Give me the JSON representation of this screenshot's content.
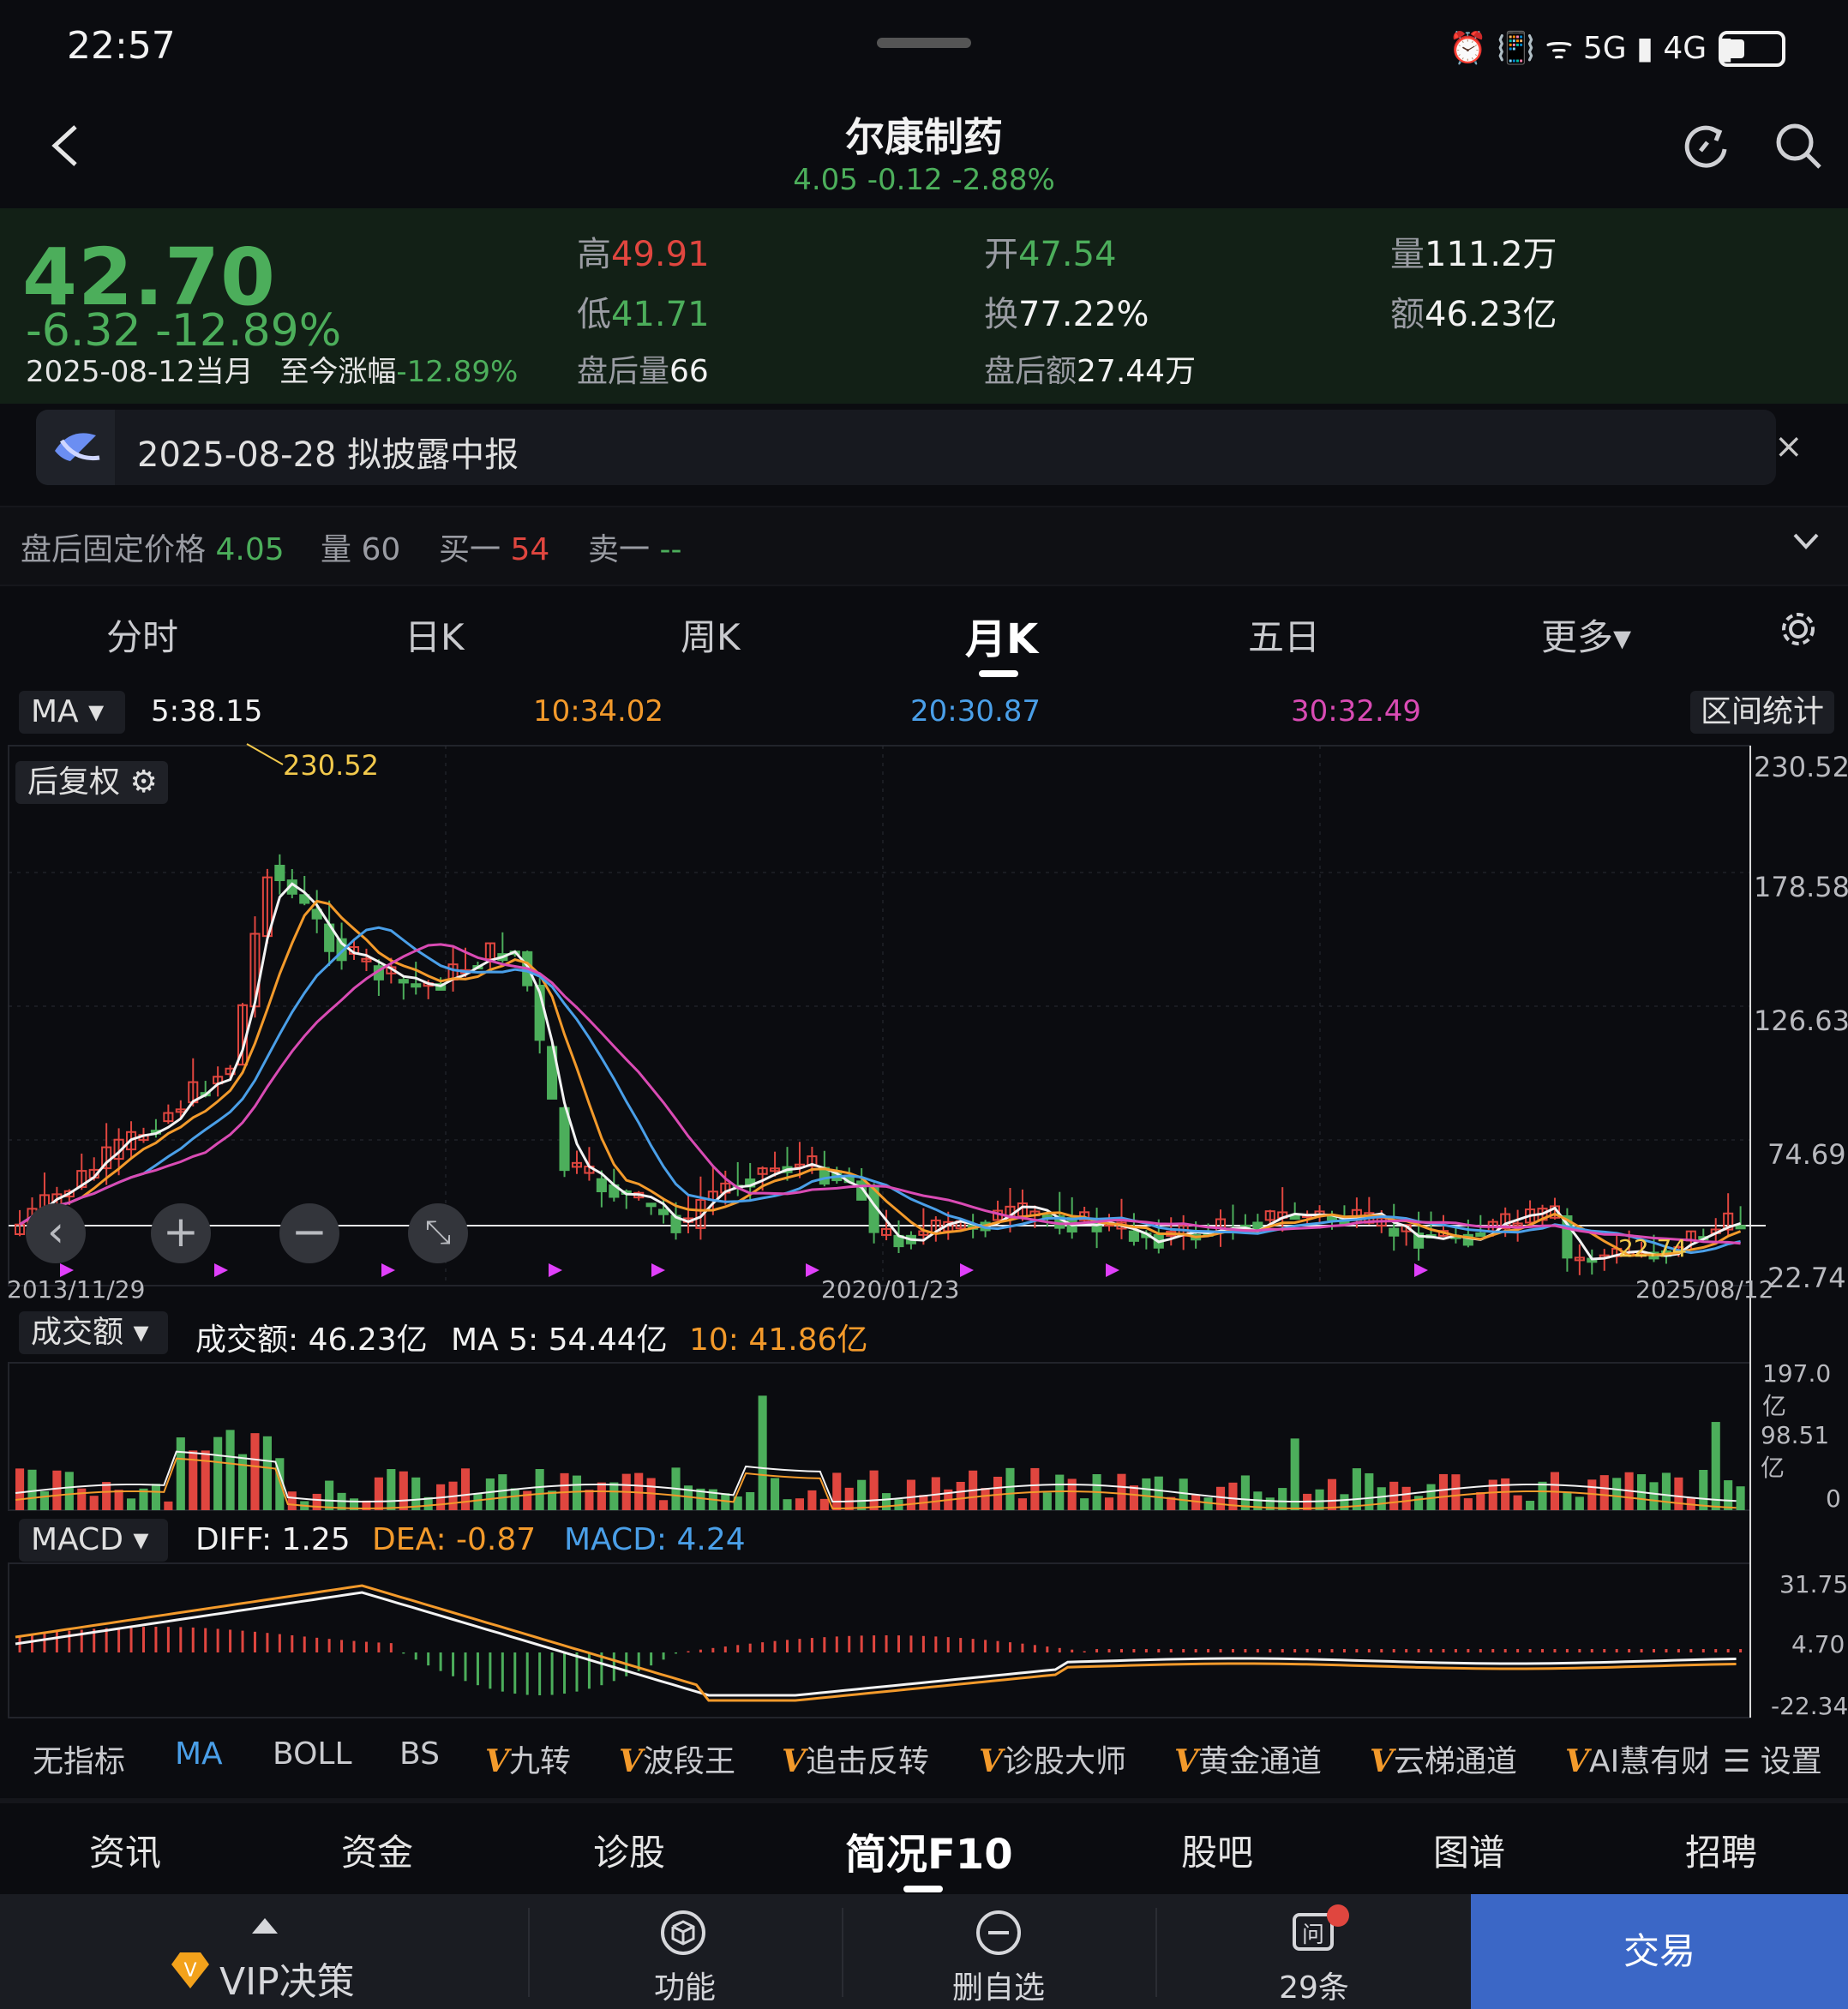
{
  "status_bar": {
    "time": "22:57",
    "icons": "⏰ 📳 ᯤ 5G ▮ 4G ▮"
  },
  "header": {
    "title": "尔康制药",
    "subtitle": "4.05  -0.12  -2.88%"
  },
  "quote": {
    "price": "42.70",
    "change": "-6.32  -12.89%",
    "date": "2025-08-12当月",
    "to_date_label": "至今涨幅",
    "to_date_value": "-12.89%",
    "high_label": "高",
    "high": "49.91",
    "low_label": "低",
    "low": "41.71",
    "ah_vol_label": "盘后量",
    "ah_vol": "66",
    "open_label": "开",
    "open": "47.54",
    "turnover_label": "换",
    "turnover": "77.22%",
    "ah_amt_label": "盘后额",
    "ah_amt": "27.44万",
    "vol_label": "量",
    "vol": "111.2万",
    "amt_label": "额",
    "amt": "46.23亿"
  },
  "notice": {
    "text": "2025-08-28 拟披露中报",
    "close": "×"
  },
  "after_hours": {
    "fixed_label": "盘后固定价格",
    "fixed_value": "4.05",
    "vol_label": "量",
    "vol_value": "60",
    "buy_label": "买一",
    "buy_value": "54",
    "sell_label": "卖一",
    "sell_value": "--"
  },
  "tabs": [
    "分时",
    "日K",
    "周K",
    "月K",
    "五日",
    "更多▾"
  ],
  "ma_legend": {
    "select": "MA ▾",
    "ma5": "5:38.15",
    "ma10": "10:34.02",
    "ma20": "20:30.87",
    "ma30": "30:32.49",
    "range_stat": "区间统计"
  },
  "chart_data": {
    "type": "candlestick",
    "adjust_tag": "后复权 ⚙",
    "y_ticks": [
      "230.52",
      "178.58",
      "126.63",
      "74.69",
      "22.74"
    ],
    "ylim": [
      22.74,
      230.52
    ],
    "max_label": "230.52",
    "x_labels": [
      "2013/11/29",
      "2020/01/23",
      "2025/08/12"
    ],
    "last_label": "22.74",
    "volume": {
      "select": "成交额 ▾",
      "amount": "成交额: 46.23亿",
      "ma5": "MA 5: 54.44亿",
      "ma10": "10: 41.86亿",
      "y_ticks": [
        "197.0亿",
        "98.51亿",
        "0"
      ]
    },
    "macd": {
      "select": "MACD ▾",
      "diff": "DIFF: 1.25",
      "dea": "DEA: -0.87",
      "macd": "MACD: 4.24",
      "y_ticks": [
        "31.75",
        "4.70",
        "-22.34"
      ]
    }
  },
  "indicators": [
    "无指标",
    "MA",
    "BOLL",
    "BS",
    "九转",
    "波段王",
    "追击反转",
    "诊股大师",
    "黄金通道",
    "云梯通道",
    "AI慧有财",
    "设置"
  ],
  "sections": [
    "资讯",
    "资金",
    "诊股",
    "简况F10",
    "股吧",
    "图谱",
    "招聘"
  ],
  "toolbar": {
    "vip": "VIP决策",
    "func": "功能",
    "del": "删自选",
    "msgs": "29条",
    "trade": "交易"
  },
  "colors": {
    "up": "#e0463f",
    "down": "#4cae5b",
    "ma5": "#f2f2f2",
    "ma10": "#f39a2b",
    "ma20": "#4a9fe8",
    "ma30": "#d94bb4",
    "trade": "#3b67c6"
  }
}
